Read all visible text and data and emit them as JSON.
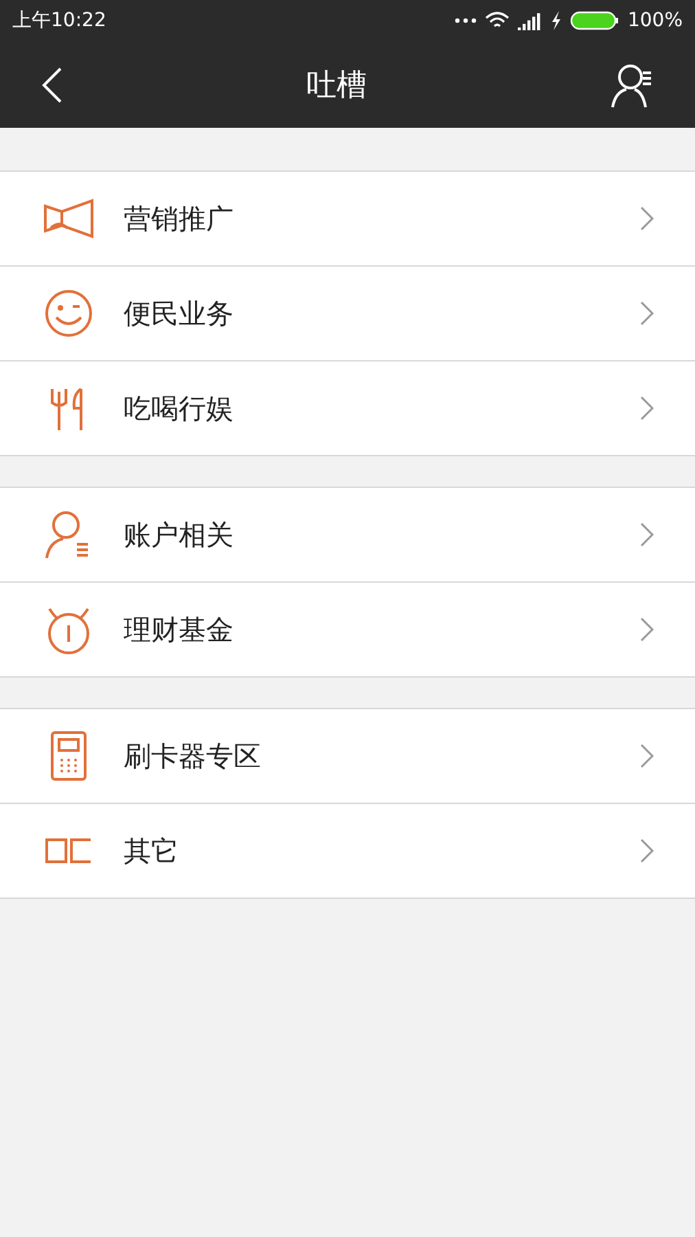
{
  "status_bar": {
    "time": "上午10:22",
    "battery": "100%"
  },
  "header": {
    "title": "吐槽"
  },
  "groups": [
    {
      "items": [
        {
          "kind": "megaphone",
          "label": "营销推广"
        },
        {
          "kind": "smile",
          "label": "便民业务"
        },
        {
          "kind": "utensils",
          "label": "吃喝行娱"
        }
      ]
    },
    {
      "items": [
        {
          "kind": "account",
          "label": "账户相关"
        },
        {
          "kind": "clock",
          "label": "理财基金"
        }
      ]
    },
    {
      "items": [
        {
          "kind": "card-reader",
          "label": "刷卡器专区"
        },
        {
          "kind": "squares",
          "label": "其它"
        }
      ]
    }
  ]
}
